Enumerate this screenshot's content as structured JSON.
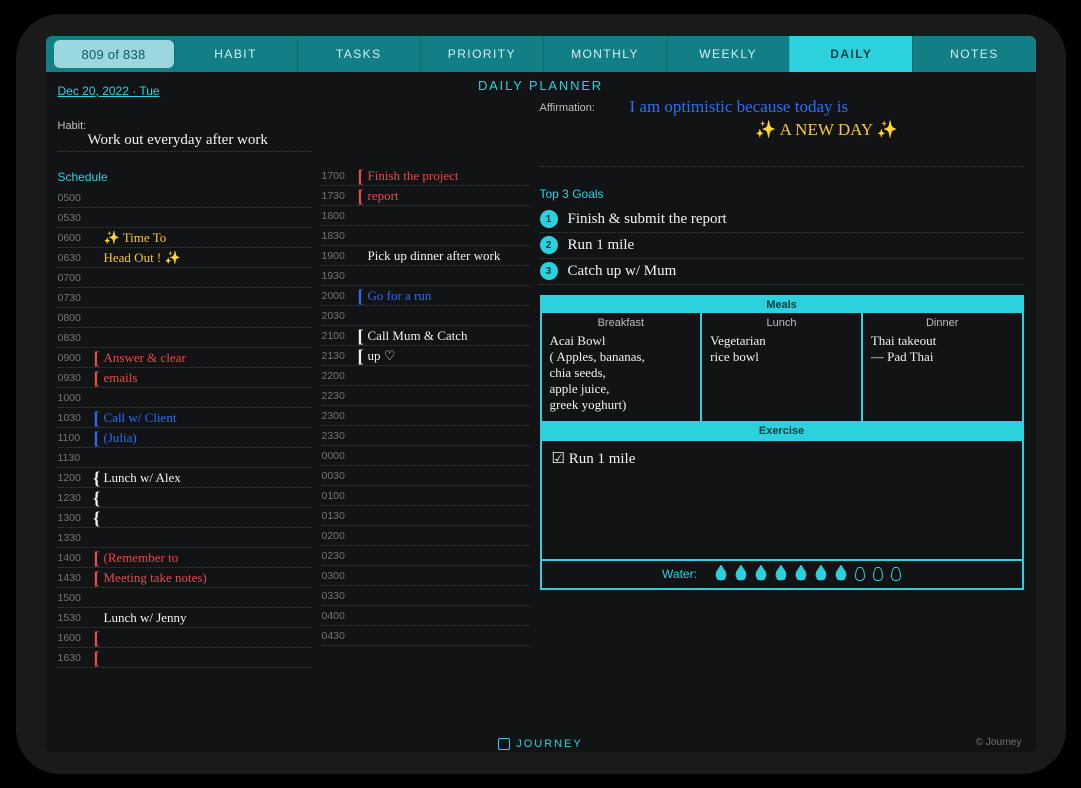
{
  "page_counter": "809 of 838",
  "tabs": {
    "habit": "HABIT",
    "tasks": "TASKS",
    "priority": "PRIORITY",
    "monthly": "MONTHLY",
    "weekly": "WEEKLY",
    "daily": "DAILY",
    "notes": "NOTES"
  },
  "active_tab": "daily",
  "date": "Dec 20, 2022 · Tue",
  "page_title": "DAILY PLANNER",
  "habit_label": "Habit:",
  "habit_text": "Work out everyday after work",
  "affirmation_label": "Affirmation:",
  "affirmation_line1": "I am optimistic because today is",
  "affirmation_line2": "✨ A NEW DAY ✨",
  "schedule_label": "Schedule",
  "schedule_left": [
    {
      "t": "0500",
      "txt": "",
      "bracket": "",
      "ink": ""
    },
    {
      "t": "0530",
      "txt": "",
      "bracket": "",
      "ink": ""
    },
    {
      "t": "0600",
      "txt": "✨ Time To",
      "bracket": "",
      "ink": "yellow"
    },
    {
      "t": "0630",
      "txt": "   Head Out ! ✨",
      "bracket": "",
      "ink": "yellow"
    },
    {
      "t": "0700",
      "txt": "",
      "bracket": "",
      "ink": ""
    },
    {
      "t": "0730",
      "txt": "",
      "bracket": "",
      "ink": ""
    },
    {
      "t": "0800",
      "txt": "",
      "bracket": "",
      "ink": ""
    },
    {
      "t": "0830",
      "txt": "",
      "bracket": "",
      "ink": ""
    },
    {
      "t": "0900",
      "txt": "Answer & clear",
      "bracket": "[",
      "ink": "red",
      "bink": "red"
    },
    {
      "t": "0930",
      "txt": "emails",
      "bracket": "[",
      "ink": "red",
      "bink": "red"
    },
    {
      "t": "1000",
      "txt": "",
      "bracket": "",
      "ink": ""
    },
    {
      "t": "1030",
      "txt": "Call w/ Client",
      "bracket": "[",
      "ink": "blue",
      "bink": "blue"
    },
    {
      "t": "1100",
      "txt": "(Julia)",
      "bracket": "[",
      "ink": "blue",
      "bink": "blue"
    },
    {
      "t": "1130",
      "txt": "",
      "bracket": "",
      "ink": ""
    },
    {
      "t": "1200",
      "txt": "Lunch w/ Alex",
      "bracket": "{",
      "ink": "white",
      "bink": "white"
    },
    {
      "t": "1230",
      "txt": "",
      "bracket": "{",
      "ink": "",
      "bink": "white"
    },
    {
      "t": "1300",
      "txt": "",
      "bracket": "{",
      "ink": "",
      "bink": "white"
    },
    {
      "t": "1330",
      "txt": "",
      "bracket": "",
      "ink": ""
    },
    {
      "t": "1400",
      "txt": "(Remember to",
      "bracket": "[",
      "ink": "red",
      "bink": "red"
    },
    {
      "t": "1430",
      "txt": "Meeting  take notes)",
      "bracket": "[",
      "ink": "red",
      "bink": "red"
    },
    {
      "t": "1500",
      "txt": "",
      "bracket": "",
      "ink": ""
    },
    {
      "t": "1530",
      "txt": "Lunch w/ Jenny",
      "bracket": "",
      "ink": "white"
    },
    {
      "t": "1600",
      "txt": "",
      "bracket": "[",
      "ink": "",
      "bink": "red"
    },
    {
      "t": "1630",
      "txt": "",
      "bracket": "[",
      "ink": "",
      "bink": "red"
    }
  ],
  "schedule_mid": [
    {
      "t": "1700",
      "txt": "Finish the project",
      "bracket": "[",
      "ink": "red",
      "bink": "red"
    },
    {
      "t": "1730",
      "txt": "report",
      "bracket": "[",
      "ink": "red",
      "bink": "red"
    },
    {
      "t": "1800",
      "txt": "",
      "bracket": "",
      "ink": ""
    },
    {
      "t": "1830",
      "txt": "",
      "bracket": "",
      "ink": ""
    },
    {
      "t": "1900",
      "txt": "Pick up dinner after work",
      "bracket": "",
      "ink": "white"
    },
    {
      "t": "1930",
      "txt": "",
      "bracket": "",
      "ink": ""
    },
    {
      "t": "2000",
      "txt": "Go for a run",
      "bracket": "[",
      "ink": "blue",
      "bink": "blue"
    },
    {
      "t": "2030",
      "txt": "",
      "bracket": "",
      "ink": ""
    },
    {
      "t": "2100",
      "txt": "Call Mum & Catch",
      "bracket": "[",
      "ink": "white",
      "bink": "white"
    },
    {
      "t": "2130",
      "txt": "up ♡",
      "bracket": "[",
      "ink": "white",
      "bink": "white"
    },
    {
      "t": "2200",
      "txt": "",
      "bracket": "",
      "ink": ""
    },
    {
      "t": "2230",
      "txt": "",
      "bracket": "",
      "ink": ""
    },
    {
      "t": "2300",
      "txt": "",
      "bracket": "",
      "ink": ""
    },
    {
      "t": "2330",
      "txt": "",
      "bracket": "",
      "ink": ""
    },
    {
      "t": "0000",
      "txt": "",
      "bracket": "",
      "ink": ""
    },
    {
      "t": "0030",
      "txt": "",
      "bracket": "",
      "ink": ""
    },
    {
      "t": "0100",
      "txt": "",
      "bracket": "",
      "ink": ""
    },
    {
      "t": "0130",
      "txt": "",
      "bracket": "",
      "ink": ""
    },
    {
      "t": "0200",
      "txt": "",
      "bracket": "",
      "ink": ""
    },
    {
      "t": "0230",
      "txt": "",
      "bracket": "",
      "ink": ""
    },
    {
      "t": "0300",
      "txt": "",
      "bracket": "",
      "ink": ""
    },
    {
      "t": "0330",
      "txt": "",
      "bracket": "",
      "ink": ""
    },
    {
      "t": "0400",
      "txt": "",
      "bracket": "",
      "ink": ""
    },
    {
      "t": "0430",
      "txt": "",
      "bracket": "",
      "ink": ""
    }
  ],
  "goals_label": "Top 3 Goals",
  "goals": [
    "Finish & submit the report",
    "Run 1 mile",
    "Catch up w/ Mum"
  ],
  "meals_label": "Meals",
  "meals": {
    "breakfast_title": "Breakfast",
    "breakfast": "Acai Bowl\n( Apples, bananas,\nchia seeds,\napple juice,\ngreek yoghurt)",
    "lunch_title": "Lunch",
    "lunch": "Vegetarian\nrice bowl",
    "dinner_title": "Dinner",
    "dinner": "Thai takeout\n— Pad Thai"
  },
  "exercise_label": "Exercise",
  "exercise_text": "☑ Run 1 mile",
  "water_label": "Water:",
  "water_filled": 7,
  "water_total": 10,
  "footer_brand": "JOURNEY",
  "copyright": "© Journey"
}
